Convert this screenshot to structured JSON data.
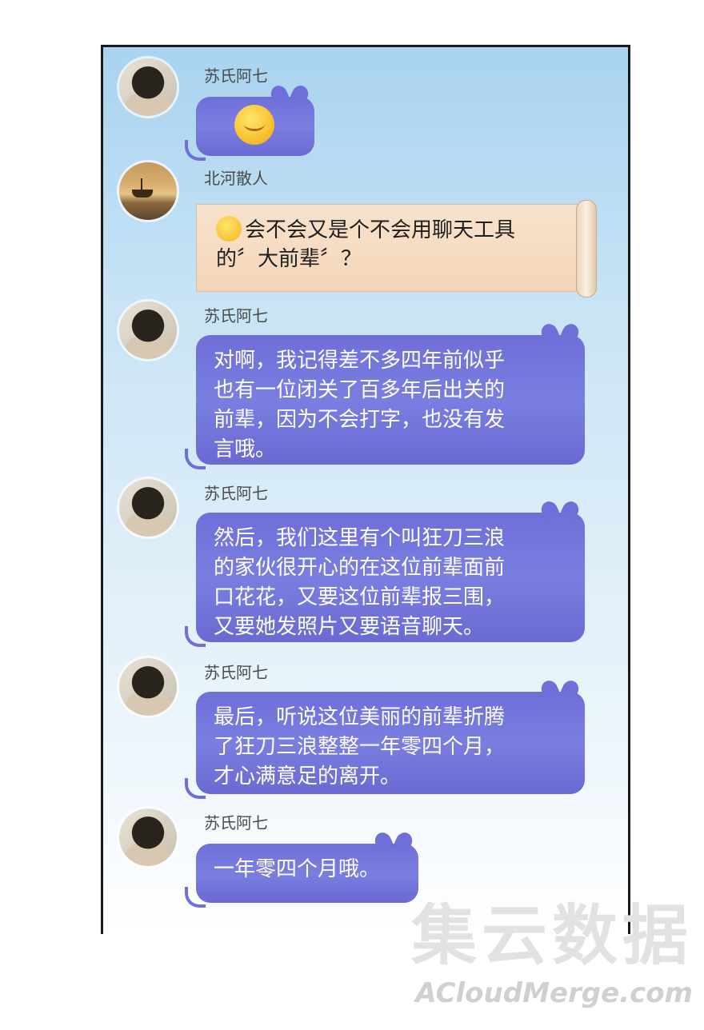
{
  "messages": [
    {
      "sender": "苏氏阿七",
      "type": "emoji",
      "emoji": "smiling-face"
    },
    {
      "sender": "北河散人",
      "type": "scroll",
      "lines": [
        "会不会又是个不会用聊天工具",
        "的〞大前辈〞？"
      ]
    },
    {
      "sender": "苏氏阿七",
      "type": "text",
      "lines": [
        "对啊，我记得差不多四年前似乎",
        "也有一位闭关了百多年后出关的",
        "前辈，因为不会打字，也没有发",
        "言哦。"
      ]
    },
    {
      "sender": "苏氏阿七",
      "type": "text",
      "lines": [
        "然后，我们这里有个叫狂刀三浪",
        "的家伙很开心的在这位前辈面前",
        "口花花，又要这位前辈报三围，",
        "又要她发照片又要语音聊天。"
      ]
    },
    {
      "sender": "苏氏阿七",
      "type": "text",
      "lines": [
        "最后，听说这位美丽的前辈折腾",
        "了狂刀三浪整整一年零四个月，",
        "才心满意足的离开。"
      ]
    },
    {
      "sender": "苏氏阿七",
      "type": "text",
      "lines": [
        "一年零四个月哦。"
      ]
    }
  ],
  "watermark": {
    "cn": "集云数据",
    "en": "ACloudMerge.com"
  },
  "colors": {
    "bubble": "#6e6fd8",
    "scroll": "#f3d6b9",
    "panel_top": "#a9d3ef"
  }
}
